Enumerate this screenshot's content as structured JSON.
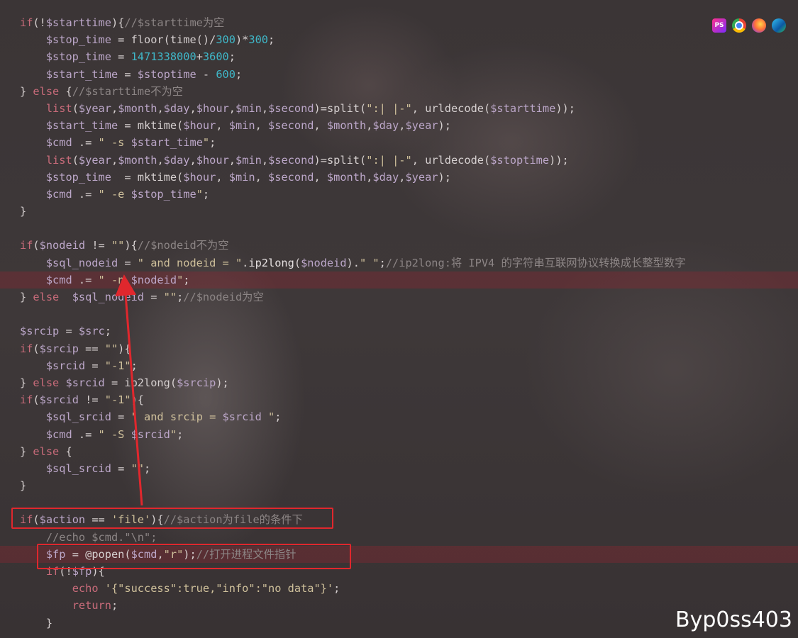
{
  "toolbar": {
    "icons": [
      {
        "name": "phpstorm-icon",
        "glyph": "PS"
      },
      {
        "name": "chrome-icon",
        "glyph": ""
      },
      {
        "name": "firefox-icon",
        "glyph": ""
      },
      {
        "name": "edge-icon",
        "glyph": ""
      }
    ]
  },
  "colors": {
    "highlight_row": "#8c2832",
    "annotation_red": "#e0272d",
    "keyword": "#c86b7a",
    "variable": "#bca7c9",
    "string": "#cfc09b",
    "number": "#3fb7c8",
    "comment": "#8c8585"
  },
  "watermark": "Byp0ss403",
  "code_lines": [
    [
      [
        "kw",
        "if"
      ],
      [
        "op",
        "(!"
      ],
      [
        "var",
        "$starttime"
      ],
      [
        "op",
        "){"
      ],
      [
        "cmt",
        "//$starttime为空"
      ]
    ],
    [
      [
        "op",
        "    "
      ],
      [
        "var",
        "$stop_time"
      ],
      [
        "op",
        " = floor(time()/"
      ],
      [
        "num",
        "300"
      ],
      [
        "op",
        ")*"
      ],
      [
        "num",
        "300"
      ],
      [
        "op",
        ";"
      ]
    ],
    [
      [
        "op",
        "    "
      ],
      [
        "var",
        "$stop_time"
      ],
      [
        "op",
        " = "
      ],
      [
        "num",
        "1471338000"
      ],
      [
        "op",
        "+"
      ],
      [
        "num",
        "3600"
      ],
      [
        "op",
        ";"
      ]
    ],
    [
      [
        "op",
        "    "
      ],
      [
        "var",
        "$start_time"
      ],
      [
        "op",
        " = "
      ],
      [
        "var",
        "$stoptime"
      ],
      [
        "op",
        " - "
      ],
      [
        "num",
        "600"
      ],
      [
        "op",
        ";"
      ]
    ],
    [
      [
        "op",
        "} "
      ],
      [
        "kw",
        "else"
      ],
      [
        "op",
        " {"
      ],
      [
        "cmt",
        "//$starttime不为空"
      ]
    ],
    [
      [
        "op",
        "    "
      ],
      [
        "kw",
        "list"
      ],
      [
        "op",
        "("
      ],
      [
        "var",
        "$year"
      ],
      [
        "op",
        ","
      ],
      [
        "var",
        "$month"
      ],
      [
        "op",
        ","
      ],
      [
        "var",
        "$day"
      ],
      [
        "op",
        ","
      ],
      [
        "var",
        "$hour"
      ],
      [
        "op",
        ","
      ],
      [
        "var",
        "$min"
      ],
      [
        "op",
        ","
      ],
      [
        "var",
        "$second"
      ],
      [
        "op",
        ")=split("
      ],
      [
        "str",
        "\":| |-\""
      ],
      [
        "op",
        ", urldecode("
      ],
      [
        "var",
        "$starttime"
      ],
      [
        "op",
        "));"
      ]
    ],
    [
      [
        "op",
        "    "
      ],
      [
        "var",
        "$start_time"
      ],
      [
        "op",
        " = mktime("
      ],
      [
        "var",
        "$hour"
      ],
      [
        "op",
        ", "
      ],
      [
        "var",
        "$min"
      ],
      [
        "op",
        ", "
      ],
      [
        "var",
        "$second"
      ],
      [
        "op",
        ", "
      ],
      [
        "var",
        "$month"
      ],
      [
        "op",
        ","
      ],
      [
        "var",
        "$day"
      ],
      [
        "op",
        ","
      ],
      [
        "var",
        "$year"
      ],
      [
        "op",
        ");"
      ]
    ],
    [
      [
        "op",
        "    "
      ],
      [
        "var",
        "$cmd"
      ],
      [
        "op",
        " .= "
      ],
      [
        "str",
        "\" -s "
      ],
      [
        "var",
        "$start_time"
      ],
      [
        "str",
        "\""
      ],
      [
        "op",
        ";"
      ]
    ],
    [
      [
        "op",
        "    "
      ],
      [
        "kw",
        "list"
      ],
      [
        "op",
        "("
      ],
      [
        "var",
        "$year"
      ],
      [
        "op",
        ","
      ],
      [
        "var",
        "$month"
      ],
      [
        "op",
        ","
      ],
      [
        "var",
        "$day"
      ],
      [
        "op",
        ","
      ],
      [
        "var",
        "$hour"
      ],
      [
        "op",
        ","
      ],
      [
        "var",
        "$min"
      ],
      [
        "op",
        ","
      ],
      [
        "var",
        "$second"
      ],
      [
        "op",
        ")=split("
      ],
      [
        "str",
        "\":| |-\""
      ],
      [
        "op",
        ", urldecode("
      ],
      [
        "var",
        "$stoptime"
      ],
      [
        "op",
        "));"
      ]
    ],
    [
      [
        "op",
        "    "
      ],
      [
        "var",
        "$stop_time"
      ],
      [
        "op",
        "  = mktime("
      ],
      [
        "var",
        "$hour"
      ],
      [
        "op",
        ", "
      ],
      [
        "var",
        "$min"
      ],
      [
        "op",
        ", "
      ],
      [
        "var",
        "$second"
      ],
      [
        "op",
        ", "
      ],
      [
        "var",
        "$month"
      ],
      [
        "op",
        ","
      ],
      [
        "var",
        "$day"
      ],
      [
        "op",
        ","
      ],
      [
        "var",
        "$year"
      ],
      [
        "op",
        ");"
      ]
    ],
    [
      [
        "op",
        "    "
      ],
      [
        "var",
        "$cmd"
      ],
      [
        "op",
        " .= "
      ],
      [
        "str",
        "\" -e "
      ],
      [
        "var",
        "$stop_time"
      ],
      [
        "str",
        "\""
      ],
      [
        "op",
        ";"
      ]
    ],
    [
      [
        "op",
        "}"
      ]
    ],
    [
      [
        "op",
        ""
      ]
    ],
    [
      [
        "kw",
        "if"
      ],
      [
        "op",
        "("
      ],
      [
        "var",
        "$nodeid"
      ],
      [
        "op",
        " != "
      ],
      [
        "str",
        "\"\""
      ],
      [
        "op",
        "){"
      ],
      [
        "cmt",
        "//$nodeid不为空"
      ]
    ],
    [
      [
        "op",
        "    "
      ],
      [
        "var",
        "$sql_nodeid"
      ],
      [
        "op",
        " = "
      ],
      [
        "str",
        "\" and nodeid = \""
      ],
      [
        "op",
        "."
      ],
      [
        "fn",
        "ip2long"
      ],
      [
        "op",
        "("
      ],
      [
        "var",
        "$nodeid"
      ],
      [
        "op",
        ")."
      ],
      [
        "str",
        "\" \""
      ],
      [
        "op",
        ";"
      ],
      [
        "cmt",
        "//ip2long:将 IPV4 的字符串互联网协议转换成长整型数字"
      ]
    ],
    [
      [
        "op",
        "    "
      ],
      [
        "var",
        "$cmd"
      ],
      [
        "op",
        " .= "
      ],
      [
        "str",
        "\" -n "
      ],
      [
        "var",
        "$nodeid"
      ],
      [
        "str",
        "\""
      ],
      [
        "op",
        ";"
      ]
    ],
    [
      [
        "op",
        "} "
      ],
      [
        "kw",
        "else"
      ],
      [
        "op",
        "  "
      ],
      [
        "var",
        "$sql_nodeid"
      ],
      [
        "op",
        " = "
      ],
      [
        "str",
        "\"\""
      ],
      [
        "op",
        ";"
      ],
      [
        "cmt",
        "//$nodeid为空"
      ]
    ],
    [
      [
        "op",
        ""
      ]
    ],
    [
      [
        "var",
        "$srcip"
      ],
      [
        "op",
        " = "
      ],
      [
        "var",
        "$src"
      ],
      [
        "op",
        ";"
      ]
    ],
    [
      [
        "kw",
        "if"
      ],
      [
        "op",
        "("
      ],
      [
        "var",
        "$srcip"
      ],
      [
        "op",
        " == "
      ],
      [
        "str",
        "\"\""
      ],
      [
        "op",
        "){"
      ]
    ],
    [
      [
        "op",
        "    "
      ],
      [
        "var",
        "$srcid"
      ],
      [
        "op",
        " = "
      ],
      [
        "str",
        "\"-1\""
      ],
      [
        "op",
        ";"
      ]
    ],
    [
      [
        "op",
        "} "
      ],
      [
        "kw",
        "else"
      ],
      [
        "op",
        " "
      ],
      [
        "var",
        "$srcid"
      ],
      [
        "op",
        " = ip2long("
      ],
      [
        "var",
        "$srcip"
      ],
      [
        "op",
        ");"
      ]
    ],
    [
      [
        "kw",
        "if"
      ],
      [
        "op",
        "("
      ],
      [
        "var",
        "$srcid"
      ],
      [
        "op",
        " != "
      ],
      [
        "str",
        "\"-1\""
      ],
      [
        "op",
        "){"
      ]
    ],
    [
      [
        "op",
        "    "
      ],
      [
        "var",
        "$sql_srcid"
      ],
      [
        "op",
        " = "
      ],
      [
        "str",
        "\" and srcip = "
      ],
      [
        "var",
        "$srcid"
      ],
      [
        "str",
        " \""
      ],
      [
        "op",
        ";"
      ]
    ],
    [
      [
        "op",
        "    "
      ],
      [
        "var",
        "$cmd"
      ],
      [
        "op",
        " .= "
      ],
      [
        "str",
        "\" -S "
      ],
      [
        "var",
        "$srcid"
      ],
      [
        "str",
        "\""
      ],
      [
        "op",
        ";"
      ]
    ],
    [
      [
        "op",
        "} "
      ],
      [
        "kw",
        "else"
      ],
      [
        "op",
        " {"
      ]
    ],
    [
      [
        "op",
        "    "
      ],
      [
        "var",
        "$sql_srcid"
      ],
      [
        "op",
        " = "
      ],
      [
        "str",
        "\"\""
      ],
      [
        "op",
        ";"
      ]
    ],
    [
      [
        "op",
        "}"
      ]
    ],
    [
      [
        "op",
        ""
      ]
    ],
    [
      [
        "kw",
        "if"
      ],
      [
        "op",
        "("
      ],
      [
        "var",
        "$action"
      ],
      [
        "op",
        " == "
      ],
      [
        "str",
        "'file'"
      ],
      [
        "op",
        "){"
      ],
      [
        "cmt",
        "//$action为file的条件下"
      ]
    ],
    [
      [
        "op",
        "    "
      ],
      [
        "cmt",
        "//echo $cmd.\"\\n\";"
      ]
    ],
    [
      [
        "op",
        "    "
      ],
      [
        "var",
        "$fp"
      ],
      [
        "op",
        " = @popen("
      ],
      [
        "var",
        "$cmd"
      ],
      [
        "op",
        ","
      ],
      [
        "str",
        "\"r\""
      ],
      [
        "op",
        ");"
      ],
      [
        "cmt",
        "//打开进程文件指针"
      ]
    ],
    [
      [
        "op",
        "    "
      ],
      [
        "kw",
        "if"
      ],
      [
        "op",
        "(!"
      ],
      [
        "var",
        "$fp"
      ],
      [
        "op",
        "){"
      ]
    ],
    [
      [
        "op",
        "        "
      ],
      [
        "kw",
        "echo"
      ],
      [
        "op",
        " "
      ],
      [
        "str",
        "'{\"success\":true,\"info\":\"no data\"}'"
      ],
      [
        "op",
        ";"
      ]
    ],
    [
      [
        "op",
        "        "
      ],
      [
        "kw",
        "return"
      ],
      [
        "op",
        ";"
      ]
    ],
    [
      [
        "op",
        "    }"
      ]
    ]
  ]
}
